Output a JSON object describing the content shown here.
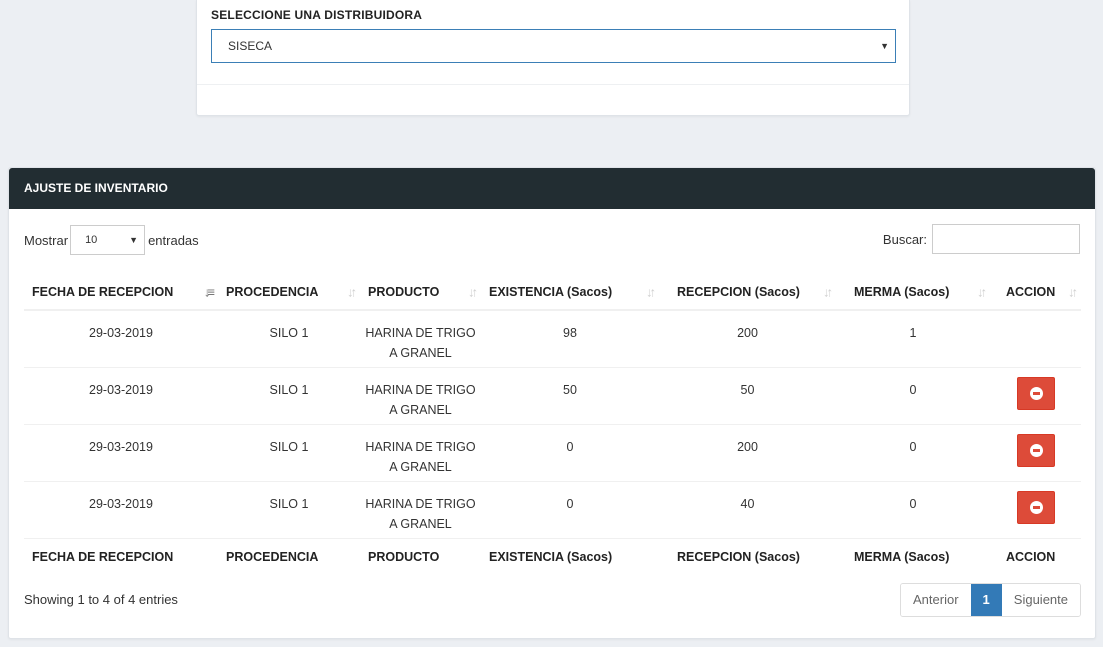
{
  "distributor": {
    "label": "SELECCIONE UNA DISTRIBUIDORA",
    "selected": "SISECA"
  },
  "box": {
    "title": "AJUSTE DE INVENTARIO",
    "length_prefix": "Mostrar",
    "length_value": "10",
    "length_suffix": "entradas",
    "search_label": "Buscar:",
    "search_value": ""
  },
  "table": {
    "columns": [
      "FECHA DE RECEPCION",
      "PROCEDENCIA",
      "PRODUCTO",
      "EXISTENCIA (Sacos)",
      "RECEPCION (Sacos)",
      "MERMA (Sacos)",
      "ACCION"
    ],
    "rows": [
      {
        "fecha": "29-03-2019",
        "procedencia": "SILO 1",
        "producto_l1": "HARINA DE TRIGO",
        "producto_l2": "A GRANEL",
        "existencia": "98",
        "recepcion": "200",
        "merma": "1",
        "has_action": false
      },
      {
        "fecha": "29-03-2019",
        "procedencia": "SILO 1",
        "producto_l1": "HARINA DE TRIGO",
        "producto_l2": "A GRANEL",
        "existencia": "50",
        "recepcion": "50",
        "merma": "0",
        "has_action": true
      },
      {
        "fecha": "29-03-2019",
        "procedencia": "SILO 1",
        "producto_l1": "HARINA DE TRIGO",
        "producto_l2": "A GRANEL",
        "existencia": "0",
        "recepcion": "200",
        "merma": "0",
        "has_action": true
      },
      {
        "fecha": "29-03-2019",
        "procedencia": "SILO 1",
        "producto_l1": "HARINA DE TRIGO",
        "producto_l2": "A GRANEL",
        "existencia": "0",
        "recepcion": "40",
        "merma": "0",
        "has_action": true
      }
    ]
  },
  "footer": {
    "info": "Showing 1 to 4 of 4 entries",
    "prev_label": "Anterior",
    "current_page": "1",
    "next_label": "Siguiente"
  },
  "colors": {
    "header_bg": "#222d32",
    "danger": "#dd4b39",
    "primary": "#337ab7"
  }
}
